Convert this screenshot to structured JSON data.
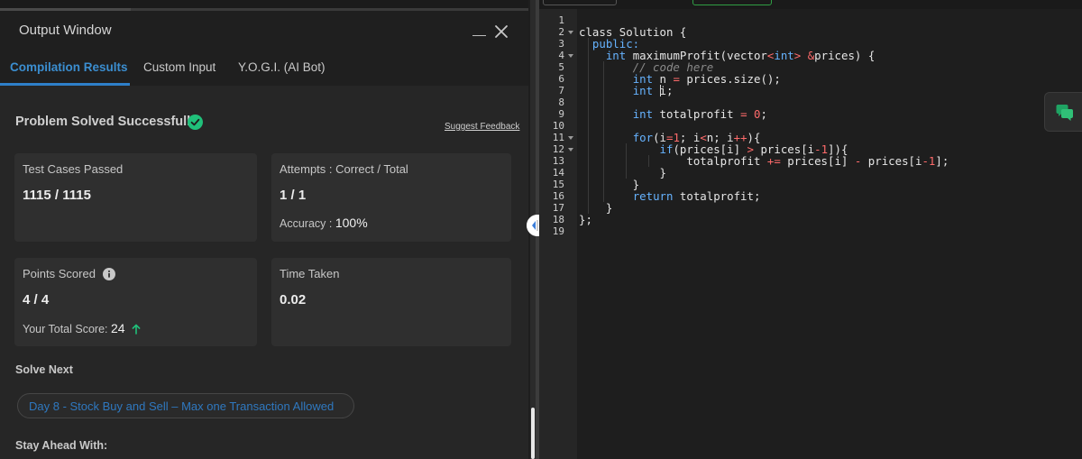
{
  "output_window": {
    "title": "Output Window",
    "tabs": [
      {
        "label": "Compilation Results",
        "active": true
      },
      {
        "label": "Custom Input",
        "active": false
      },
      {
        "label": "Y.O.G.I. (AI Bot)",
        "active": false
      }
    ]
  },
  "result": {
    "status": "Problem Solved Successfully",
    "feedback_link": "Suggest Feedback",
    "cards": {
      "test_cases": {
        "label": "Test Cases Passed",
        "value": "1115 / 1115"
      },
      "attempts": {
        "label": "Attempts : Correct / Total",
        "value": "1 / 1",
        "sub_label": "Accuracy :",
        "sub_value": "100%"
      },
      "points": {
        "label": "Points Scored",
        "value": "4 / 4",
        "sub_label": "Your Total Score:",
        "sub_value": "24"
      },
      "time": {
        "label": "Time Taken",
        "value": "0.02"
      }
    }
  },
  "solve_next": {
    "title": "Solve Next",
    "problem": "Day 8 - Stock Buy and Sell – Max one Transaction Allowed"
  },
  "stay_ahead": {
    "title": "Stay Ahead With:"
  },
  "editor": {
    "line_numbers": [
      "1",
      "2",
      "3",
      "4",
      "5",
      "6",
      "7",
      "8",
      "9",
      "10",
      "11",
      "12",
      "13",
      "14",
      "15",
      "16",
      "17",
      "18",
      "19"
    ],
    "lines": [
      [],
      [
        {
          "t": "class Solution {",
          "c": ""
        }
      ],
      [
        {
          "t": "  public:",
          "c": "kw"
        }
      ],
      [
        {
          "t": "    ",
          "c": ""
        },
        {
          "t": "int",
          "c": "kw"
        },
        {
          "t": " maximumProfit(vector",
          "c": ""
        },
        {
          "t": "<",
          "c": "op"
        },
        {
          "t": "int",
          "c": "kw"
        },
        {
          "t": ">",
          "c": "op"
        },
        {
          "t": " ",
          "c": ""
        },
        {
          "t": "&",
          "c": "op"
        },
        {
          "t": "prices) {",
          "c": ""
        }
      ],
      [
        {
          "t": "        // code here",
          "c": "cm"
        }
      ],
      [
        {
          "t": "        ",
          "c": ""
        },
        {
          "t": "int",
          "c": "kw"
        },
        {
          "t": " n ",
          "c": ""
        },
        {
          "t": "=",
          "c": "op"
        },
        {
          "t": " prices.size();",
          "c": ""
        }
      ],
      [
        {
          "t": "        ",
          "c": ""
        },
        {
          "t": "int",
          "c": "kw"
        },
        {
          "t": " i;",
          "c": ""
        }
      ],
      [],
      [
        {
          "t": "        ",
          "c": ""
        },
        {
          "t": "int",
          "c": "kw"
        },
        {
          "t": " totalprofit ",
          "c": ""
        },
        {
          "t": "=",
          "c": "op"
        },
        {
          "t": " ",
          "c": ""
        },
        {
          "t": "0",
          "c": "op"
        },
        {
          "t": ";",
          "c": ""
        }
      ],
      [],
      [
        {
          "t": "        ",
          "c": ""
        },
        {
          "t": "for",
          "c": "kw"
        },
        {
          "t": "(i",
          "c": ""
        },
        {
          "t": "=1",
          "c": "op"
        },
        {
          "t": "; i",
          "c": ""
        },
        {
          "t": "<",
          "c": "op"
        },
        {
          "t": "n; i",
          "c": ""
        },
        {
          "t": "++",
          "c": "op"
        },
        {
          "t": "){",
          "c": ""
        }
      ],
      [
        {
          "t": "            ",
          "c": ""
        },
        {
          "t": "if",
          "c": "kw"
        },
        {
          "t": "(prices[i] ",
          "c": ""
        },
        {
          "t": ">",
          "c": "op"
        },
        {
          "t": " prices[i",
          "c": ""
        },
        {
          "t": "-1",
          "c": "op"
        },
        {
          "t": "]){",
          "c": ""
        }
      ],
      [
        {
          "t": "                totalprofit ",
          "c": ""
        },
        {
          "t": "+=",
          "c": "op"
        },
        {
          "t": " prices[i] ",
          "c": ""
        },
        {
          "t": "-",
          "c": "op"
        },
        {
          "t": " prices[i",
          "c": ""
        },
        {
          "t": "-1",
          "c": "op"
        },
        {
          "t": "];",
          "c": ""
        }
      ],
      [
        {
          "t": "            }",
          "c": ""
        }
      ],
      [
        {
          "t": "        }",
          "c": ""
        }
      ],
      [
        {
          "t": "        ",
          "c": ""
        },
        {
          "t": "return",
          "c": "kw"
        },
        {
          "t": " totalprofit;",
          "c": ""
        }
      ],
      [
        {
          "t": "    }",
          "c": ""
        }
      ],
      [
        {
          "t": "};",
          "c": ""
        }
      ],
      []
    ]
  },
  "colors": {
    "accent_blue": "#2e7fc9",
    "success_green": "#20c07a",
    "keyword": "#66b3ff",
    "operator": "#ff6b6b",
    "comment": "#8a8a8a"
  },
  "icons": [
    "minimize-icon",
    "close-icon",
    "check-circle-icon",
    "info-icon",
    "arrow-up-icon",
    "resize-handle-icon",
    "chat-icon",
    "fold-arrow-icon"
  ]
}
